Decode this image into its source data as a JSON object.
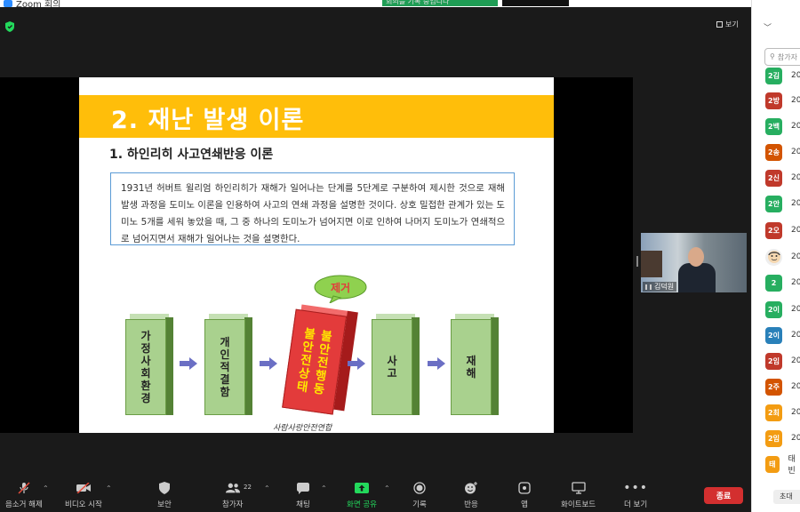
{
  "app": {
    "title": "Zoom 회의"
  },
  "banner": {
    "recording_text": "회의를 기록 중입니다",
    "dark_button": ""
  },
  "view": {
    "label": "보기"
  },
  "slide": {
    "heading": "2. 재난 발생 이론",
    "subheading": "1. 하인리히 사고연쇄반응 이론",
    "description": "1931년 허버트 윌리엄 하인리히가 재해가 일어나는 단계를 5단계로 구분하여 제시한 것으로 재해 발생 과정을 도미노 이론을 인용하여 사고의 연쇄 과정을 설명한 것이다. 상호 밀접한 관계가 있는 도미노 5개를 세워 놓았을 때, 그 중 하나의 도미노가 넘어지면 이로 인하여 나머지 도미노가 연쇄적으로 넘어지면서 재해가 일어나는 것을 설명한다.",
    "dominoes": [
      {
        "label": "가정사회환경"
      },
      {
        "label": "개인적 결함"
      },
      {
        "label_col1": "불안전상태",
        "label_col2": "불안전행동"
      },
      {
        "label": "사 고"
      },
      {
        "label": "재 해"
      }
    ],
    "bubble": "제거",
    "signature": "사람사랑안전연합",
    "colors": {
      "gold": "#ffbe0a",
      "green": "#a9d18e",
      "red": "#e33b3b",
      "arrow": "#6b6fc4"
    }
  },
  "video": {
    "name": "김덕원"
  },
  "toolbar": {
    "mute": "음소거 해제",
    "video": "비디오 시작",
    "security": "보안",
    "participants": "참가자",
    "participants_count": "22",
    "chat": "채팅",
    "share": "화면 공유",
    "record": "기록",
    "reactions": "반응",
    "apps": "앱",
    "whiteboard": "화이트보드",
    "more": "더 보기",
    "end": "종료"
  },
  "panel": {
    "search_placeholder": "참가자",
    "participants": [
      {
        "initials": "2김",
        "name": "20",
        "color": "#27ae60"
      },
      {
        "initials": "2방",
        "name": "20",
        "color": "#c0392b"
      },
      {
        "initials": "2백",
        "name": "20",
        "color": "#27ae60"
      },
      {
        "initials": "2송",
        "name": "20",
        "color": "#d35400"
      },
      {
        "initials": "2신",
        "name": "20",
        "color": "#c0392b"
      },
      {
        "initials": "2안",
        "name": "20",
        "color": "#27ae60"
      },
      {
        "initials": "2오",
        "name": "20",
        "color": "#c0392b"
      },
      {
        "initials": "",
        "name": "20",
        "color": "#eeeeee"
      },
      {
        "initials": "2",
        "name": "20",
        "color": "#27ae60"
      },
      {
        "initials": "2이",
        "name": "20",
        "color": "#27ae60"
      },
      {
        "initials": "2이",
        "name": "20",
        "color": "#2980b9"
      },
      {
        "initials": "2임",
        "name": "20",
        "color": "#c0392b"
      },
      {
        "initials": "2주",
        "name": "20",
        "color": "#d35400"
      },
      {
        "initials": "2최",
        "name": "20",
        "color": "#f39c12"
      },
      {
        "initials": "2임",
        "name": "20",
        "color": "#f39c12"
      },
      {
        "initials": "태",
        "name": "태빈",
        "color": "#f39c12"
      }
    ],
    "invite": "초대"
  }
}
